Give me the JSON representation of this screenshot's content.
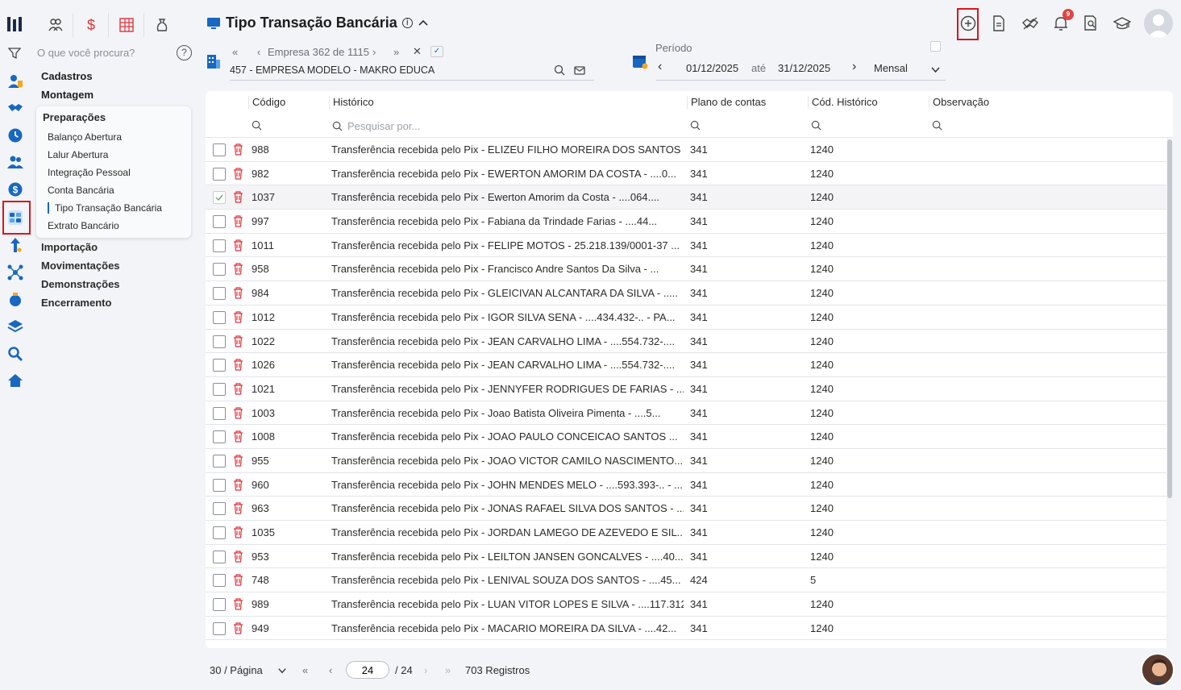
{
  "colors": {
    "accent": "#1867c0",
    "danger": "#d9161d",
    "badge": "#e04545"
  },
  "sidebar": {
    "search_placeholder": "O que você procura?",
    "help": "?",
    "sections_top": [
      "Cadastros",
      "Montagem"
    ],
    "group_title": "Preparações",
    "group_items": [
      {
        "label": "Balanço Abertura",
        "active": false
      },
      {
        "label": "Lalur Abertura",
        "active": false
      },
      {
        "label": "Integração Pessoal",
        "active": false
      },
      {
        "label": "Conta Bancária",
        "active": false
      },
      {
        "label": "Tipo Transação Bancária",
        "active": true
      },
      {
        "label": "Extrato Bancário",
        "active": false
      }
    ],
    "sections_bottom": [
      "Importação",
      "Movimentações",
      "Demonstrações",
      "Encerramento"
    ]
  },
  "header": {
    "title": "Tipo Transação Bancária",
    "info": "i",
    "notifications_count": "9"
  },
  "empresa": {
    "nav_label": "Empresa 362 de 1115",
    "name": "457 - EMPRESA MODELO - MAKRO EDUCA"
  },
  "periodo": {
    "label": "Período",
    "start": "01/12/2025",
    "until": "até",
    "end": "31/12/2025",
    "mode": "Mensal"
  },
  "table": {
    "columns": [
      "Código",
      "Histórico",
      "Plano de contas",
      "Cód. Histórico",
      "Observação"
    ],
    "search_placeholder": "Pesquisar por...",
    "rows": [
      {
        "codigo": "988",
        "historico": "Transferência recebida pelo Pix - ELIZEU FILHO MOREIRA DOS SANTOS ...",
        "plano": "341",
        "cod_hist": "1240",
        "checked": false
      },
      {
        "codigo": "982",
        "historico": "Transferência recebida pelo Pix - EWERTON AMORIM DA COSTA - ....0...",
        "plano": "341",
        "cod_hist": "1240",
        "checked": false
      },
      {
        "codigo": "1037",
        "historico": "Transferência recebida pelo Pix - Ewerton Amorim da Costa - ....064....",
        "plano": "341",
        "cod_hist": "1240",
        "checked": true
      },
      {
        "codigo": "997",
        "historico": "Transferência recebida pelo Pix - Fabiana da Trindade Farias - ....44...",
        "plano": "341",
        "cod_hist": "1240",
        "checked": false
      },
      {
        "codigo": "1011",
        "historico": "Transferência recebida pelo Pix - FELIPE MOTOS - 25.218.139/0001-37 ...",
        "plano": "341",
        "cod_hist": "1240",
        "checked": false
      },
      {
        "codigo": "958",
        "historico": "Transferência recebida pelo Pix - Francisco Andre Santos Da Silva - ...",
        "plano": "341",
        "cod_hist": "1240",
        "checked": false
      },
      {
        "codigo": "984",
        "historico": "Transferência recebida pelo Pix - GLEICIVAN ALCANTARA DA SILVA - .....",
        "plano": "341",
        "cod_hist": "1240",
        "checked": false
      },
      {
        "codigo": "1012",
        "historico": "Transferência recebida pelo Pix - IGOR SILVA SENA - ....434.432-.. - PA...",
        "plano": "341",
        "cod_hist": "1240",
        "checked": false
      },
      {
        "codigo": "1022",
        "historico": "Transferência recebida pelo Pix - JEAN CARVALHO LIMA - ....554.732-....",
        "plano": "341",
        "cod_hist": "1240",
        "checked": false
      },
      {
        "codigo": "1026",
        "historico": "Transferência recebida pelo Pix - JEAN CARVALHO LIMA - ....554.732-....",
        "plano": "341",
        "cod_hist": "1240",
        "checked": false
      },
      {
        "codigo": "1021",
        "historico": "Transferência recebida pelo Pix - JENNYFER RODRIGUES DE FARIAS - .....",
        "plano": "341",
        "cod_hist": "1240",
        "checked": false
      },
      {
        "codigo": "1003",
        "historico": "Transferência recebida pelo Pix - Joao Batista Oliveira Pimenta - ....5...",
        "plano": "341",
        "cod_hist": "1240",
        "checked": false
      },
      {
        "codigo": "1008",
        "historico": "Transferência recebida pelo Pix - JOAO PAULO CONCEICAO SANTOS ...",
        "plano": "341",
        "cod_hist": "1240",
        "checked": false
      },
      {
        "codigo": "955",
        "historico": "Transferência recebida pelo Pix - JOAO VICTOR CAMILO NASCIMENTO...",
        "plano": "341",
        "cod_hist": "1240",
        "checked": false
      },
      {
        "codigo": "960",
        "historico": "Transferência recebida pelo Pix - JOHN MENDES MELO - ....593.393-.. - ...",
        "plano": "341",
        "cod_hist": "1240",
        "checked": false
      },
      {
        "codigo": "963",
        "historico": "Transferência recebida pelo Pix - JONAS RAFAEL SILVA DOS SANTOS - ...",
        "plano": "341",
        "cod_hist": "1240",
        "checked": false
      },
      {
        "codigo": "1035",
        "historico": "Transferência recebida pelo Pix - JORDAN LAMEGO DE AZEVEDO E SIL...",
        "plano": "341",
        "cod_hist": "1240",
        "checked": false
      },
      {
        "codigo": "953",
        "historico": "Transferência recebida pelo Pix - LEILTON JANSEN GONCALVES - ....40...",
        "plano": "341",
        "cod_hist": "1240",
        "checked": false
      },
      {
        "codigo": "748",
        "historico": "Transferência recebida pelo Pix - LENIVAL SOUZA DOS SANTOS - ....45...",
        "plano": "424",
        "cod_hist": "5",
        "checked": false
      },
      {
        "codigo": "989",
        "historico": "Transferência recebida pelo Pix - LUAN VITOR LOPES E SILVA - ....117.312...",
        "plano": "341",
        "cod_hist": "1240",
        "checked": false
      },
      {
        "codigo": "949",
        "historico": "Transferência recebida pelo Pix - MACARIO MOREIRA DA SILVA - ....42...",
        "plano": "341",
        "cod_hist": "1240",
        "checked": false
      }
    ]
  },
  "pager": {
    "per_page": "30 / Página",
    "current": "24",
    "total_pages": "/ 24",
    "total_records": "703 Registros"
  }
}
